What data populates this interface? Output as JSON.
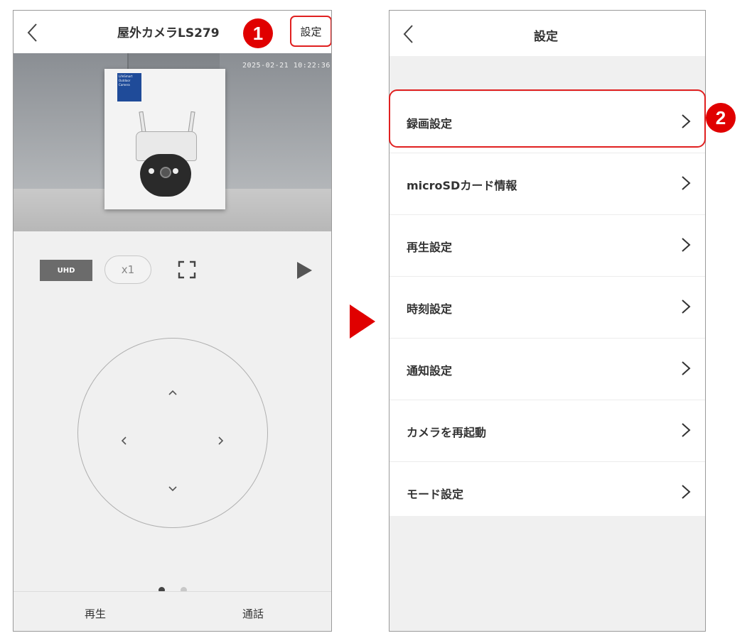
{
  "left_screen": {
    "title": "屋外カメラLS279",
    "settings_label": "設定",
    "timestamp": "2025-02-21 10:22:36",
    "box_label": "LifeSmart Outdoor Camera",
    "quality_label": "UHD",
    "zoom_label": "x1",
    "tabs": [
      "再生",
      "通話"
    ],
    "page_count": 2,
    "active_page": 1
  },
  "callouts": {
    "step1": "1",
    "step2": "2"
  },
  "right_screen": {
    "title": "設定",
    "items": [
      {
        "label": "録画設定"
      },
      {
        "label": "microSDカード情報"
      },
      {
        "label": "再生設定"
      },
      {
        "label": "時刻設定"
      },
      {
        "label": "通知設定"
      },
      {
        "label": "カメラを再起動"
      },
      {
        "label": "モード設定"
      }
    ]
  },
  "colors": {
    "highlight": "#e02020",
    "badge": "#e00000",
    "arrow": "#e00000",
    "background": "#f0f0f0"
  }
}
